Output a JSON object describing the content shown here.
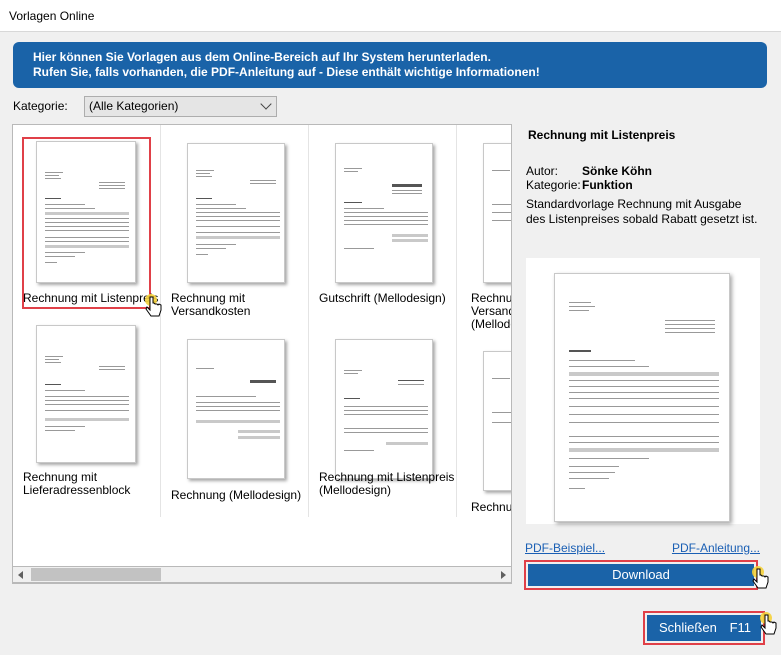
{
  "window": {
    "title": "Vorlagen Online"
  },
  "banner": {
    "line1": "Hier können Sie Vorlagen aus dem Online-Bereich auf Ihr System herunterladen.",
    "line2": "Rufen Sie, falls vorhanden, die PDF-Anleitung auf - Diese enthält wichtige Informationen!"
  },
  "kategorie": {
    "label": "Kategorie:",
    "selected": "(Alle Kategorien)"
  },
  "templates": [
    {
      "label": "Rechnung mit Listenpreis",
      "selected": true
    },
    {
      "label": "Rechnung mit Versandkosten",
      "selected": false
    },
    {
      "label": "Gutschrift (Mellodesign)",
      "selected": false
    },
    {
      "label": "Rechnung mit Versandkosten (Mellodesign)",
      "selected": false
    },
    {
      "label": "Rechnung mit Lieferadressenblock",
      "selected": false
    },
    {
      "label": "Rechnung (Mellodesign)",
      "selected": false
    },
    {
      "label": "Rechnung mit Listenpreis (Mellodesign)",
      "selected": false
    },
    {
      "label": "Rechnung",
      "selected": false
    }
  ],
  "detail": {
    "title": "Rechnung mit Listenpreis",
    "autor_label": "Autor:",
    "autor": "Sönke Köhn",
    "kategorie_label": "Kategorie:",
    "kategorie": "Funktion",
    "description": "Standardvorlage Rechnung mit Ausgabe des Listenpreises sobald Rabatt gesetzt ist.",
    "pdf_beispiel": "PDF-Beispiel...",
    "pdf_anleitung": "PDF-Anleitung..."
  },
  "buttons": {
    "download": "Download",
    "close": "Schließen",
    "close_shortcut": "F11"
  },
  "colors": {
    "accent": "#1a63a8",
    "highlight": "#e04048",
    "link": "#1a5fb4"
  }
}
